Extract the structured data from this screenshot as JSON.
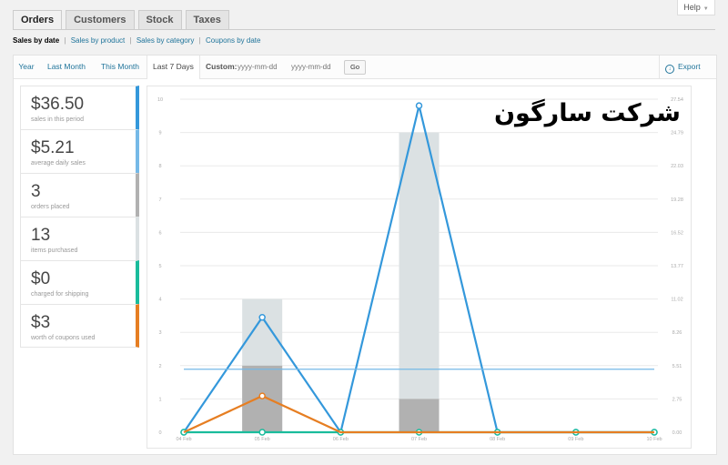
{
  "tabs": [
    {
      "label": "Orders"
    },
    {
      "label": "Customers"
    },
    {
      "label": "Stock"
    },
    {
      "label": "Taxes"
    }
  ],
  "help": {
    "label": "Help"
  },
  "subnav": {
    "current": "Sales by date",
    "links": [
      "Sales by product",
      "Sales by category",
      "Coupons by date"
    ],
    "separator": "|"
  },
  "ranges": {
    "year": "Year",
    "last_month": "Last Month",
    "this_month": "This Month",
    "last_7_days": "Last 7 Days",
    "active": "Last 7 Days"
  },
  "custom": {
    "label": "Custom:",
    "start_placeholder": "yyyy-mm-dd",
    "end_placeholder": "yyyy-mm-dd",
    "go_label": "Go"
  },
  "export": {
    "label": "Export CSV"
  },
  "legend": [
    {
      "value": "$36.50",
      "label": "sales in this period",
      "color": "#3498db"
    },
    {
      "value": "$5.21",
      "label": "average daily sales",
      "color": "#75b9e7"
    },
    {
      "value": "3",
      "label": "orders placed",
      "color": "#b1b1b1"
    },
    {
      "value": "13",
      "label": "items purchased",
      "color": "#dbe1e3"
    },
    {
      "value": "$0",
      "label": "charged for shipping",
      "color": "#1abc9c"
    },
    {
      "value": "$3",
      "label": "worth of coupons used",
      "color": "#e67e22"
    }
  ],
  "watermark": "شرکت سارگون",
  "chart_data": {
    "type": "bar",
    "categories": [
      "04 Feb",
      "05 Feb",
      "06 Feb",
      "07 Feb",
      "08 Feb",
      "09 Feb",
      "10 Feb"
    ],
    "y_left_ticks": [
      "0",
      "1",
      "2",
      "3",
      "4",
      "5",
      "6",
      "7",
      "8",
      "9",
      "10"
    ],
    "y_right_ticks": [
      "0.00",
      "2.75",
      "5.51",
      "8.26",
      "11.02",
      "13.77",
      "16.52",
      "19.28",
      "22.03",
      "24.79",
      "27.54"
    ],
    "ylim_left": [
      0,
      10
    ],
    "ylim_right": [
      0,
      27.54
    ],
    "series": [
      {
        "name": "items purchased",
        "kind": "bar",
        "color": "#dbe1e3",
        "values": [
          0,
          4,
          0,
          9,
          0,
          0,
          0
        ]
      },
      {
        "name": "orders placed",
        "kind": "bar",
        "color": "#b1b1b1",
        "values": [
          0,
          2,
          0,
          1,
          0,
          0,
          0
        ]
      },
      {
        "name": "sales in this period",
        "kind": "line",
        "color": "#3498db",
        "axis": "right",
        "values": [
          0,
          9.5,
          0,
          27,
          0,
          0,
          0
        ]
      },
      {
        "name": "average daily sales",
        "kind": "line",
        "color": "#75b9e7",
        "axis": "right",
        "values": [
          5.21,
          5.21,
          5.21,
          5.21,
          5.21,
          5.21,
          5.21
        ]
      },
      {
        "name": "charged for shipping",
        "kind": "line",
        "color": "#1abc9c",
        "axis": "right",
        "values": [
          0,
          0,
          0,
          0,
          0,
          0,
          0
        ]
      },
      {
        "name": "worth of coupons used",
        "kind": "line",
        "color": "#e67e22",
        "axis": "right",
        "values": [
          0,
          3,
          0,
          0,
          0,
          0,
          0
        ]
      }
    ],
    "grid": true
  }
}
